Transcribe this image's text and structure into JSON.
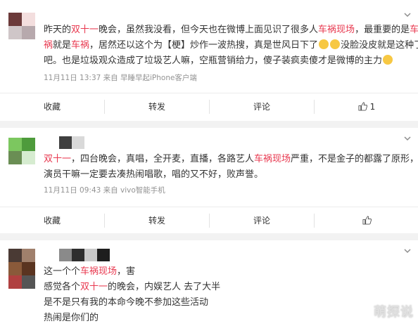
{
  "comments": [
    {
      "lines": [
        [
          {
            "t": "昨天的"
          },
          {
            "t": "双十一",
            "hl": true
          },
          {
            "t": "晚会，虽然我没看，但今天也在微博上面见识了很多人"
          },
          {
            "t": "车祸现场",
            "hl": true
          },
          {
            "t": "，最重要的是"
          },
          {
            "t": "车",
            "hl": true
          }
        ],
        [
          {
            "t": "祸",
            "hl": true
          },
          {
            "t": "就是"
          },
          {
            "t": "车祸",
            "hl": true
          },
          {
            "t": "，居然还以这个为【梗】炒作一波热搜，真是世风日下了"
          },
          {
            "t": "",
            "emoji": true
          },
          {
            "t": "",
            "emoji": true
          },
          {
            "t": "没脸没皮就是这种了"
          }
        ],
        [
          {
            "t": "吧。也是垃圾观众造成了垃圾艺人嘛，空瓶营销给力，傻子装疯卖傻才是微博的主力"
          },
          {
            "t": "",
            "emoji": true
          }
        ]
      ],
      "meta": "11月11日 13:37  来自 早睡早起iPhone客户端",
      "actions": [
        "收藏",
        "转发",
        "评论",
        "1"
      ]
    },
    {
      "lines": [
        [
          {
            "t": "双十一",
            "hl": true
          },
          {
            "t": "，四台晚会，真唱，全开麦，直播，各路艺人"
          },
          {
            "t": "车祸现场",
            "hl": true
          },
          {
            "t": "严重，不是金子的都露了原形，"
          }
        ],
        [
          {
            "t": "演员干嘛一定要去凑热闹唱歌，唱的又不好，败声誉。"
          }
        ]
      ],
      "meta": "11月11日 09:43  来自 vivo智能手机",
      "actions": [
        "收藏",
        "转发",
        "评论",
        ""
      ]
    },
    {
      "lines": [
        [
          {
            "t": "这一个个"
          },
          {
            "t": "车祸现场",
            "hl": true
          },
          {
            "t": "，害"
          }
        ],
        [
          {
            "t": "感觉各个"
          },
          {
            "t": "双十一",
            "hl": true
          },
          {
            "t": "的晚会，内娱艺人 去了大半"
          }
        ],
        [
          {
            "t": "是不是只有我的本命今晚不参加这些活动"
          }
        ],
        [
          {
            "t": "热闹是你们的"
          }
        ]
      ]
    }
  ],
  "watermark": "萌探说",
  "colors": {
    "highlight": "#e8384f",
    "meta": "#939393",
    "separator": "#f2f2f2"
  }
}
